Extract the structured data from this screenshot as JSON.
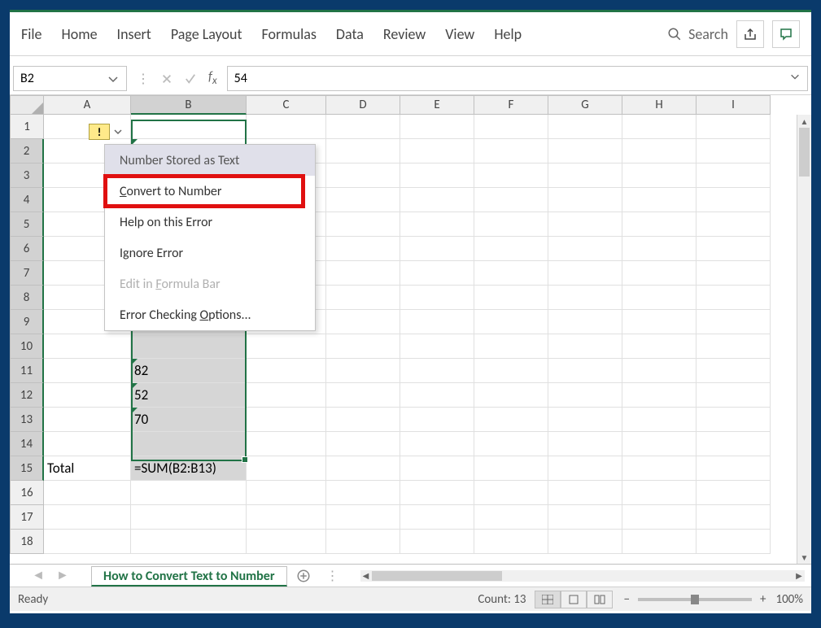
{
  "ribbon": {
    "tabs": [
      "File",
      "Home",
      "Insert",
      "Page Layout",
      "Formulas",
      "Data",
      "Review",
      "View",
      "Help"
    ],
    "search_placeholder": "Search"
  },
  "formula_bar": {
    "name_box": "B2",
    "formula": "54"
  },
  "columns": [
    "A",
    "B",
    "C",
    "D",
    "E",
    "F",
    "G",
    "H",
    "I"
  ],
  "visible_rows": 18,
  "selected_column": "B",
  "selected_rows_from": 2,
  "selected_rows_to": 15,
  "cells": {
    "B2": "54",
    "B11": "82",
    "B12": "52",
    "B13": "70",
    "A15": "Total",
    "B15": "=SUM(B2:B13)"
  },
  "text_stored_cells": [
    "B2",
    "B11",
    "B12",
    "B13"
  ],
  "error_menu": {
    "header": "Number Stored as Text",
    "items": [
      {
        "label": "Convert to Number",
        "mnemonic": "C",
        "highlighted": true
      },
      {
        "label": "Help on this Error"
      },
      {
        "label": "Ignore Error"
      },
      {
        "label": "Edit in Formula Bar",
        "mnemonic": "F",
        "disabled": true
      },
      {
        "label": "Error Checking Options...",
        "mnemonic": "O"
      }
    ]
  },
  "sheet_tab": "How to Convert Text to Number",
  "status": {
    "ready": "Ready",
    "count": "Count: 13",
    "zoom": "100%"
  }
}
